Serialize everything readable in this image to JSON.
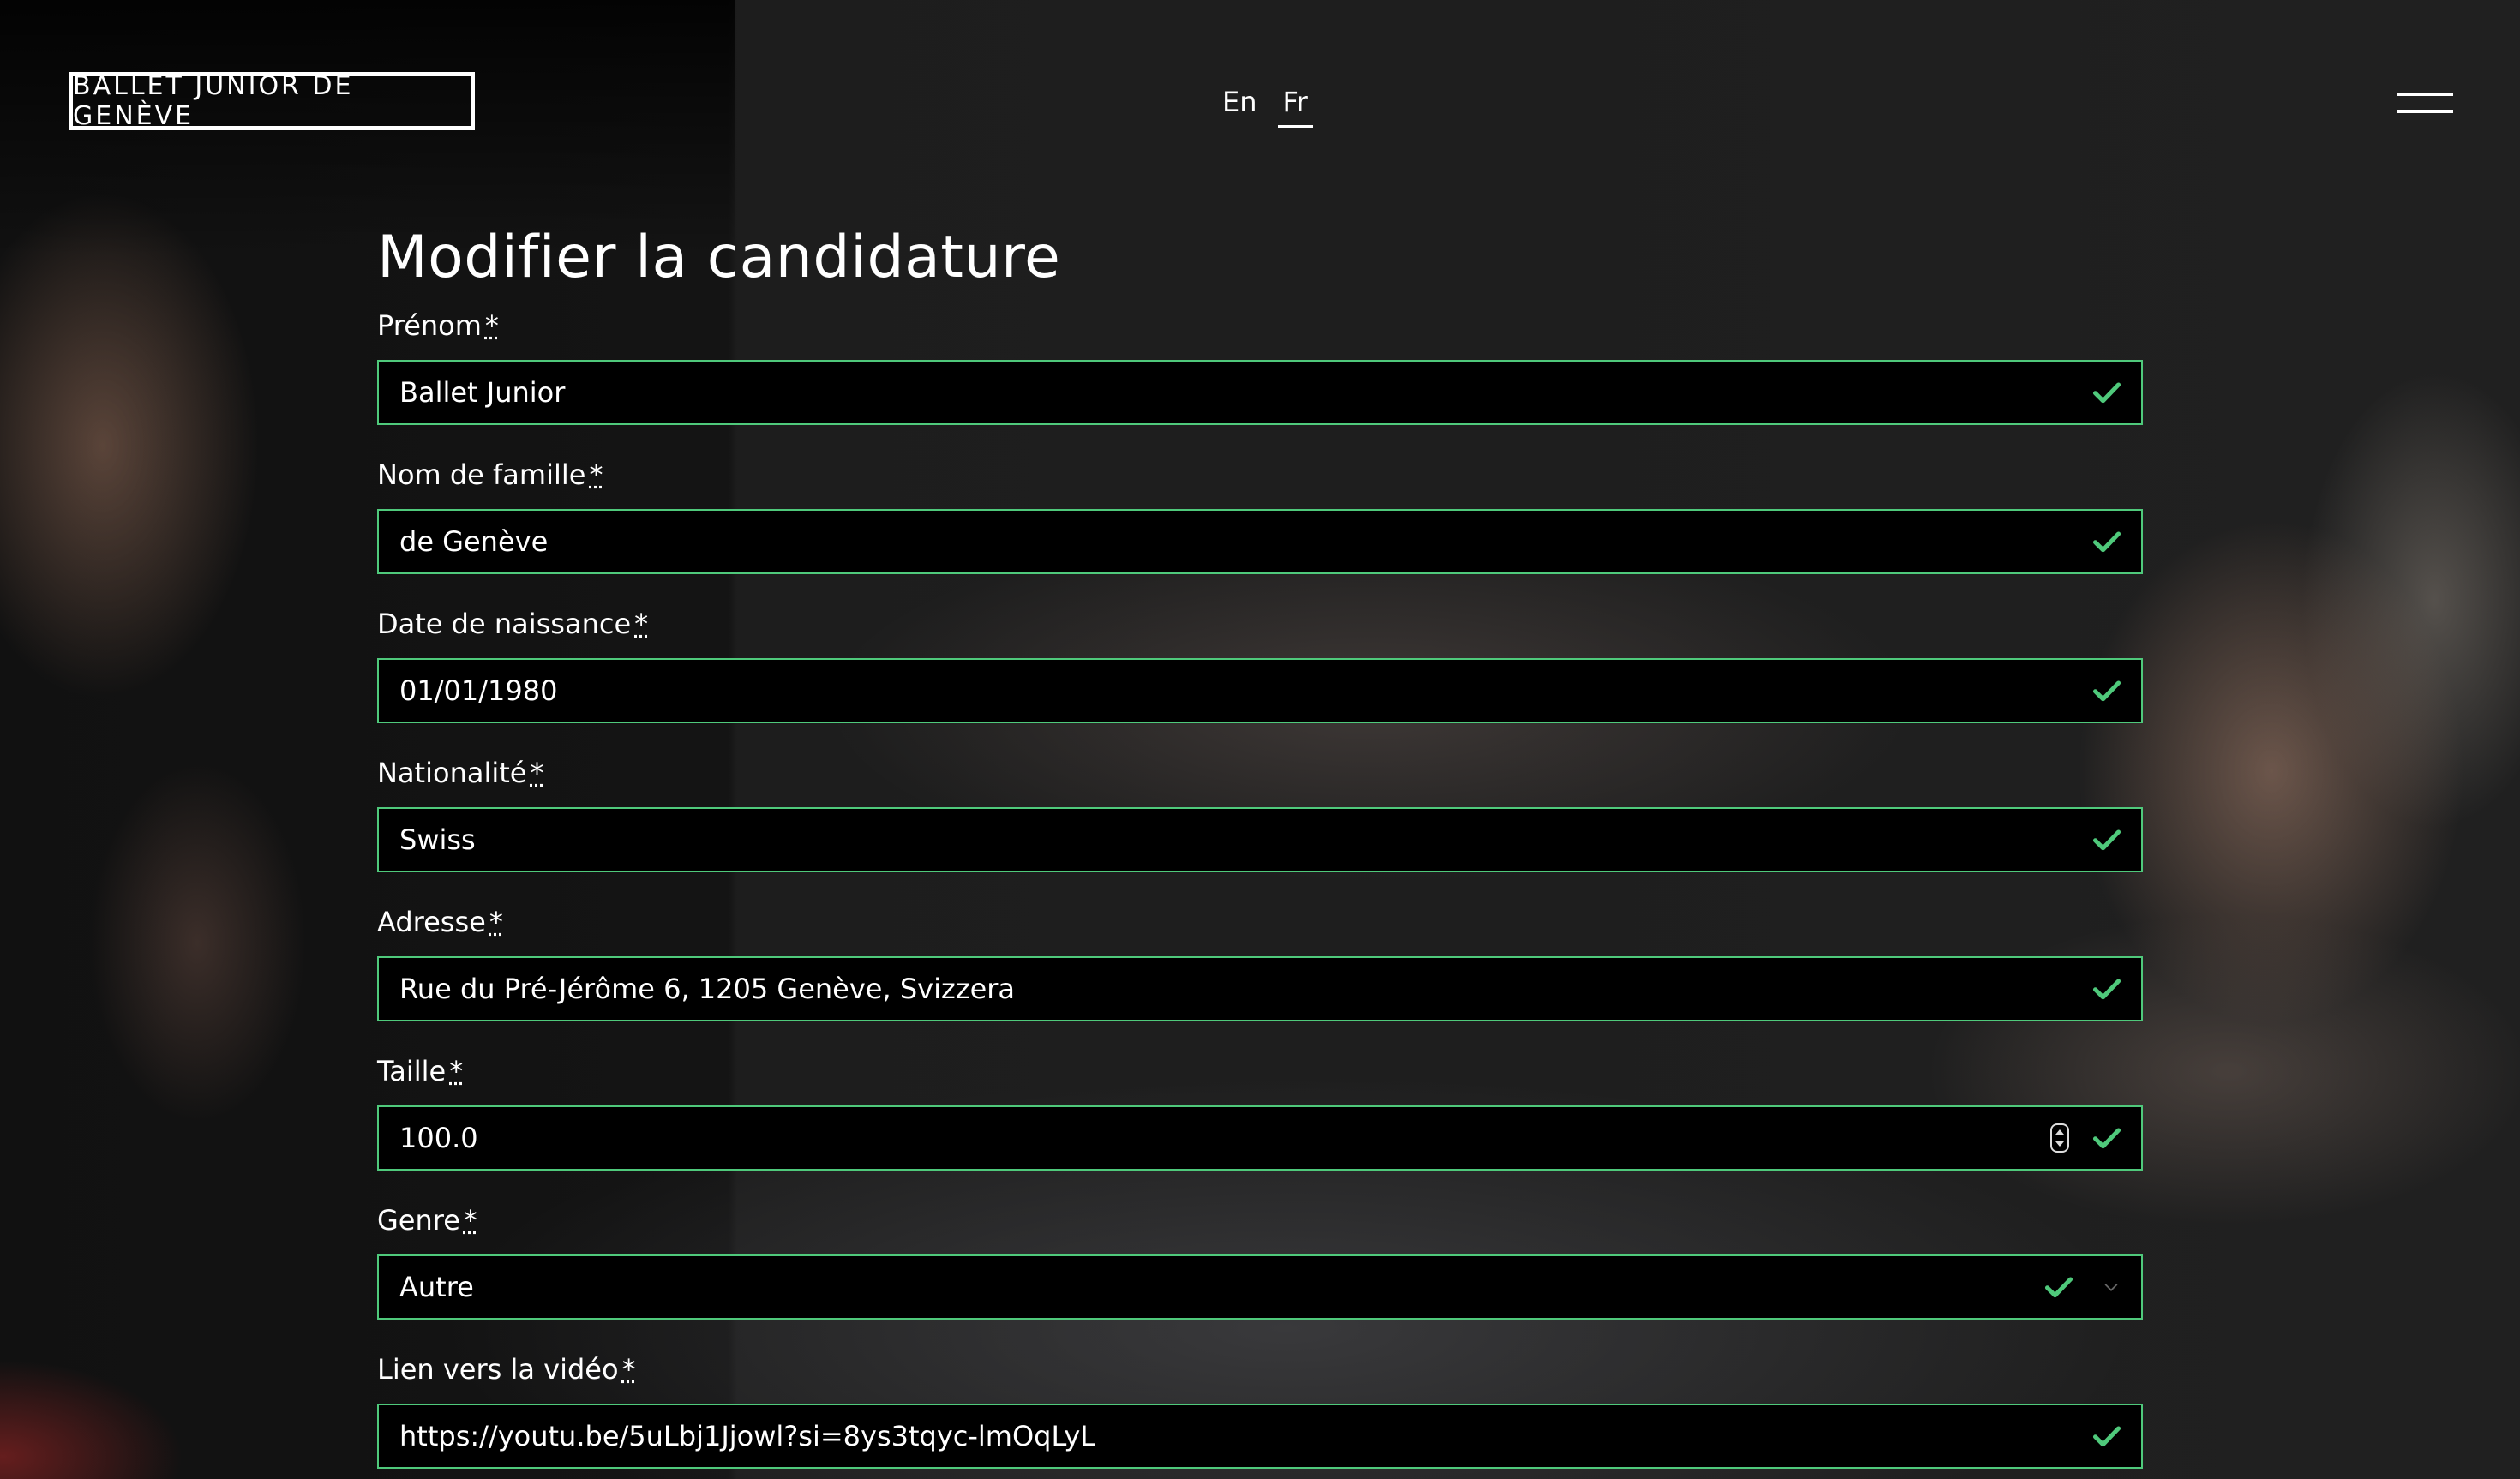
{
  "header": {
    "logo_text": "BALLET JUNIOR DE GENÈVE",
    "languages": [
      {
        "label": "En",
        "active": false
      },
      {
        "label": "Fr",
        "active": true
      }
    ],
    "menu_icon": "hamburger-menu-icon"
  },
  "form": {
    "title": "Modifier la candidature",
    "required_marker": "*",
    "fields": [
      {
        "label": "Prénom",
        "value": "Ballet Junior"
      },
      {
        "label": "Nom de famille",
        "value": "de Genève"
      },
      {
        "label": "Date de naissance",
        "value": "01/01/1980"
      },
      {
        "label": "Nationalité",
        "value": "Swiss"
      },
      {
        "label": "Adresse",
        "value": "Rue du Pré-Jérôme 6, 1205 Genève, Svizzera"
      },
      {
        "label": "Taille",
        "value": "100.0"
      },
      {
        "label": "Genre",
        "value": "Autre"
      },
      {
        "label": "Lien vers la vidéo",
        "value": "https://youtu.be/5uLbj1Jjowl?si=8ys3tqyc-lmOqLyL"
      }
    ]
  },
  "colors": {
    "valid_border": "#4fc97b",
    "valid_check": "#4fc97b",
    "background": "#000000",
    "text": "#ffffff"
  },
  "icons": {
    "valid": "check-icon",
    "number": "spinner-icon",
    "select": "chevron-down-icon"
  }
}
